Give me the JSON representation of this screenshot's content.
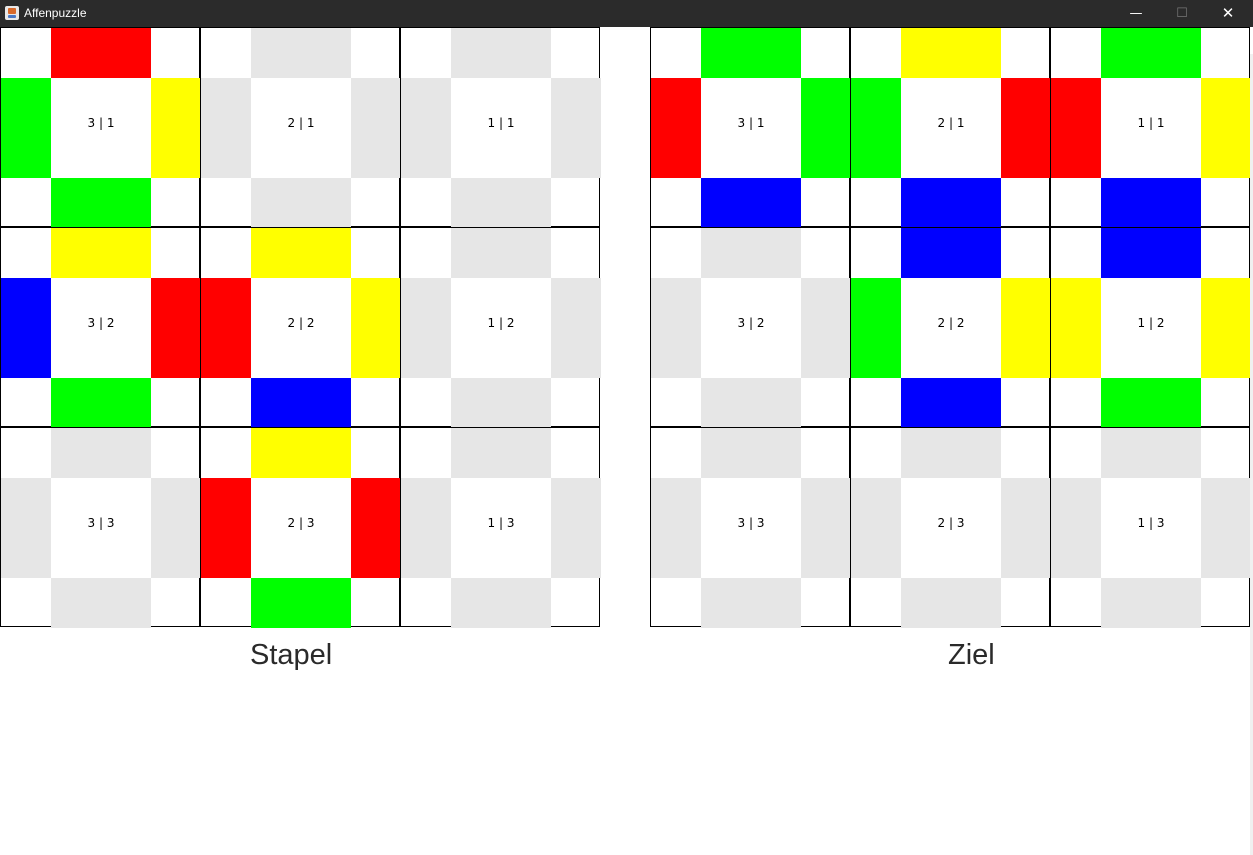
{
  "window": {
    "title": "Affenpuzzle",
    "controls": {
      "minimize": "—",
      "maximize": "☐",
      "close": "✕"
    }
  },
  "colors": {
    "red": "#ff0000",
    "green": "#00ff00",
    "yellow": "#ffff00",
    "blue": "#0000ff",
    "empty": "#e6e6e6"
  },
  "boards": [
    {
      "id": "stapel",
      "caption": "Stapel",
      "tiles": [
        {
          "label": "3 | 1",
          "top": "red",
          "left": "green",
          "right": "yellow",
          "bottom": "green"
        },
        {
          "label": "2 | 1",
          "top": "empty",
          "left": "empty",
          "right": "empty",
          "bottom": "empty"
        },
        {
          "label": "1 | 1",
          "top": "empty",
          "left": "empty",
          "right": "empty",
          "bottom": "empty"
        },
        {
          "label": "3 | 2",
          "top": "yellow",
          "left": "blue",
          "right": "red",
          "bottom": "green"
        },
        {
          "label": "2 | 2",
          "top": "yellow",
          "left": "red",
          "right": "yellow",
          "bottom": "blue"
        },
        {
          "label": "1 | 2",
          "top": "empty",
          "left": "empty",
          "right": "empty",
          "bottom": "empty"
        },
        {
          "label": "3 | 3",
          "top": "empty",
          "left": "empty",
          "right": "empty",
          "bottom": "empty"
        },
        {
          "label": "2 | 3",
          "top": "yellow",
          "left": "red",
          "right": "red",
          "bottom": "green"
        },
        {
          "label": "1 | 3",
          "top": "empty",
          "left": "empty",
          "right": "empty",
          "bottom": "empty"
        }
      ]
    },
    {
      "id": "ziel",
      "caption": "Ziel",
      "tiles": [
        {
          "label": "3 | 1",
          "top": "green",
          "left": "red",
          "right": "green",
          "bottom": "blue"
        },
        {
          "label": "2 | 1",
          "top": "yellow",
          "left": "green",
          "right": "red",
          "bottom": "blue"
        },
        {
          "label": "1 | 1",
          "top": "green",
          "left": "red",
          "right": "yellow",
          "bottom": "blue"
        },
        {
          "label": "3 | 2",
          "top": "empty",
          "left": "empty",
          "right": "empty",
          "bottom": "empty"
        },
        {
          "label": "2 | 2",
          "top": "blue",
          "left": "green",
          "right": "yellow",
          "bottom": "blue"
        },
        {
          "label": "1 | 2",
          "top": "blue",
          "left": "yellow",
          "right": "yellow",
          "bottom": "green"
        },
        {
          "label": "3 | 3",
          "top": "empty",
          "left": "empty",
          "right": "empty",
          "bottom": "empty"
        },
        {
          "label": "2 | 3",
          "top": "empty",
          "left": "empty",
          "right": "empty",
          "bottom": "empty"
        },
        {
          "label": "1 | 3",
          "top": "empty",
          "left": "empty",
          "right": "empty",
          "bottom": "empty"
        }
      ]
    }
  ]
}
